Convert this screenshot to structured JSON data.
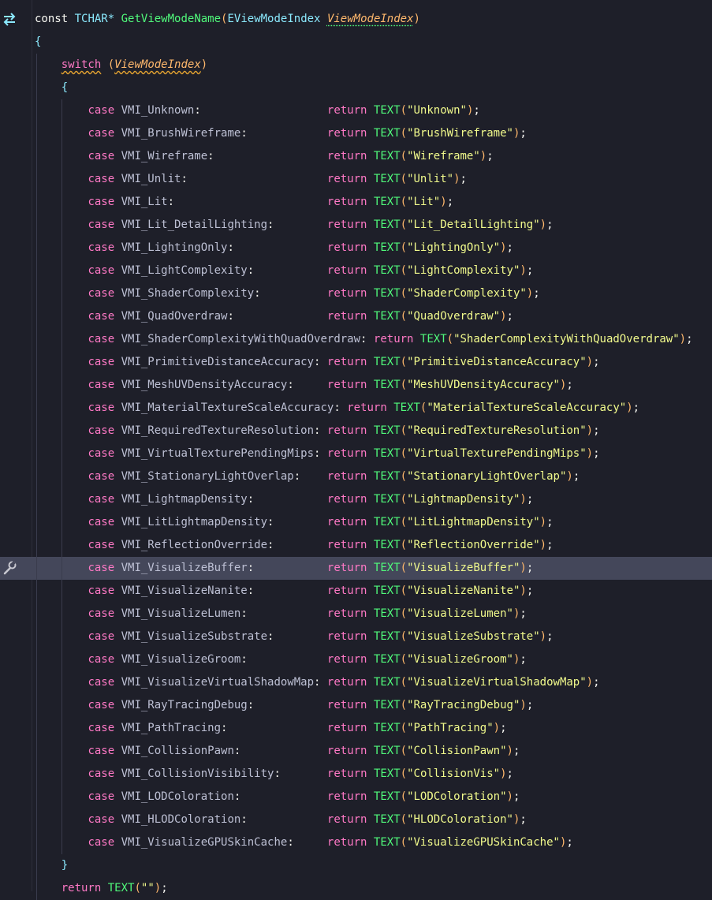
{
  "signature": {
    "const": "const",
    "type": "TCHAR*",
    "func": "GetViewModeName",
    "param_type": "EViewModeIndex",
    "param_name": "ViewModeIndex"
  },
  "open_brace": "{",
  "close_brace": "}",
  "switch_kw": "switch",
  "switch_arg": "ViewModeIndex",
  "case_kw": "case",
  "return_kw": "return",
  "text_macro": "TEXT",
  "cases": [
    {
      "id": "VMI_Unknown",
      "str": "Unknown"
    },
    {
      "id": "VMI_BrushWireframe",
      "str": "BrushWireframe"
    },
    {
      "id": "VMI_Wireframe",
      "str": "Wireframe"
    },
    {
      "id": "VMI_Unlit",
      "str": "Unlit"
    },
    {
      "id": "VMI_Lit",
      "str": "Lit"
    },
    {
      "id": "VMI_Lit_DetailLighting",
      "str": "Lit_DetailLighting"
    },
    {
      "id": "VMI_LightingOnly",
      "str": "LightingOnly"
    },
    {
      "id": "VMI_LightComplexity",
      "str": "LightComplexity"
    },
    {
      "id": "VMI_ShaderComplexity",
      "str": "ShaderComplexity"
    },
    {
      "id": "VMI_QuadOverdraw",
      "str": "QuadOverdraw"
    },
    {
      "id": "VMI_ShaderComplexityWithQuadOverdraw",
      "str": "ShaderComplexityWithQuadOverdraw"
    },
    {
      "id": "VMI_PrimitiveDistanceAccuracy",
      "str": "PrimitiveDistanceAccuracy"
    },
    {
      "id": "VMI_MeshUVDensityAccuracy",
      "str": "MeshUVDensityAccuracy"
    },
    {
      "id": "VMI_MaterialTextureScaleAccuracy",
      "str": "MaterialTextureScaleAccuracy"
    },
    {
      "id": "VMI_RequiredTextureResolution",
      "str": "RequiredTextureResolution"
    },
    {
      "id": "VMI_VirtualTexturePendingMips",
      "str": "VirtualTexturePendingMips"
    },
    {
      "id": "VMI_StationaryLightOverlap",
      "str": "StationaryLightOverlap"
    },
    {
      "id": "VMI_LightmapDensity",
      "str": "LightmapDensity"
    },
    {
      "id": "VMI_LitLightmapDensity",
      "str": "LitLightmapDensity"
    },
    {
      "id": "VMI_ReflectionOverride",
      "str": "ReflectionOverride"
    },
    {
      "id": "VMI_VisualizeBuffer",
      "str": "VisualizeBuffer"
    },
    {
      "id": "VMI_VisualizeNanite",
      "str": "VisualizeNanite"
    },
    {
      "id": "VMI_VisualizeLumen",
      "str": "VisualizeLumen"
    },
    {
      "id": "VMI_VisualizeSubstrate",
      "str": "VisualizeSubstrate"
    },
    {
      "id": "VMI_VisualizeGroom",
      "str": "VisualizeGroom"
    },
    {
      "id": "VMI_VisualizeVirtualShadowMap",
      "str": "VisualizeVirtualShadowMap"
    },
    {
      "id": "VMI_RayTracingDebug",
      "str": "RayTracingDebug"
    },
    {
      "id": "VMI_PathTracing",
      "str": "PathTracing"
    },
    {
      "id": "VMI_CollisionPawn",
      "str": "CollisionPawn"
    },
    {
      "id": "VMI_CollisionVisibility",
      "str": "CollisionVis"
    },
    {
      "id": "VMI_LODColoration",
      "str": "LODColoration"
    },
    {
      "id": "VMI_HLODColoration",
      "str": "HLODColoration"
    },
    {
      "id": "VMI_VisualizeGPUSkinCache",
      "str": "VisualizeGPUSkinCache"
    }
  ],
  "final_return_str": "",
  "highlighted_case": "VMI_VisualizeBuffer",
  "gutter_icons": {
    "top": "swap-arrows-icon",
    "highlighted": "wrench-icon"
  },
  "colors": {
    "background": "#1e1f29",
    "highlight": "#44475a",
    "keyword": "#ff79c6",
    "type": "#8be9fd",
    "function": "#50fa7b",
    "string": "#f1fa8c",
    "param": "#ffb86c"
  }
}
